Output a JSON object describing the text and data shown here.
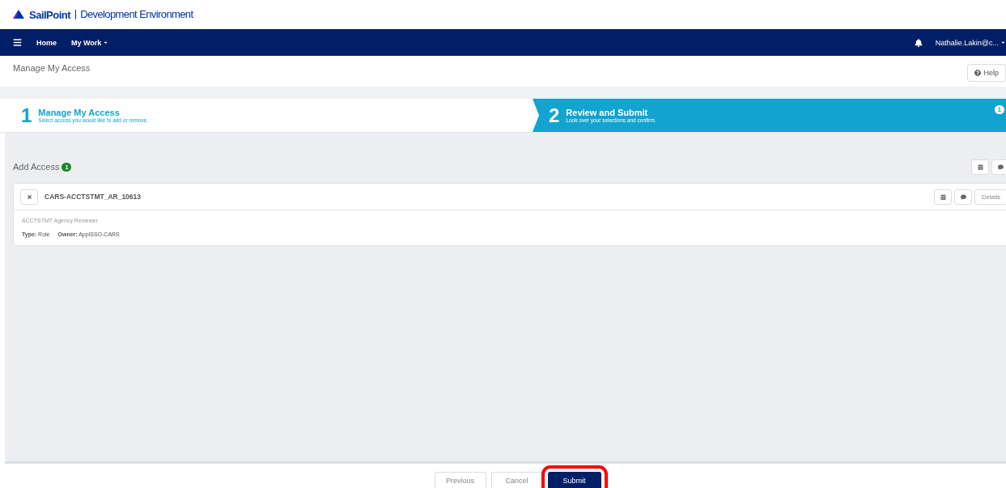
{
  "brand": {
    "name": "SailPoint",
    "environment": "Development Environment"
  },
  "nav": {
    "items": [
      {
        "label": "Home",
        "dropdown": false
      },
      {
        "label": "My Work",
        "dropdown": true
      }
    ],
    "user": "Nathalie.Lakin@c..."
  },
  "page": {
    "title": "Manage My Access",
    "help": "Help"
  },
  "steps": [
    {
      "number": "1",
      "title": "Manage My Access",
      "subtitle": "Select access you would like to add or remove.",
      "selected": false
    },
    {
      "number": "2",
      "title": "Review and Submit",
      "subtitle": "Look over your selections and confirm.",
      "selected": true,
      "badge": "1"
    }
  ],
  "section": {
    "title": "Add Access",
    "count": "1"
  },
  "items": [
    {
      "name": "CARS-ACCTSTMT_AR_10613",
      "description": "ACCTSTMT Agency Reviewer",
      "type_label": "Type:",
      "type": "Role",
      "owner_label": "Owner:",
      "owner": "ApplSSO-CARS",
      "details": "Details"
    }
  ],
  "footer": {
    "buttons": [
      {
        "label": "Previous",
        "kind": "default",
        "highlighted": false
      },
      {
        "label": "Cancel",
        "kind": "default",
        "highlighted": false
      },
      {
        "label": "Submit",
        "kind": "primary",
        "highlighted": true
      }
    ]
  }
}
